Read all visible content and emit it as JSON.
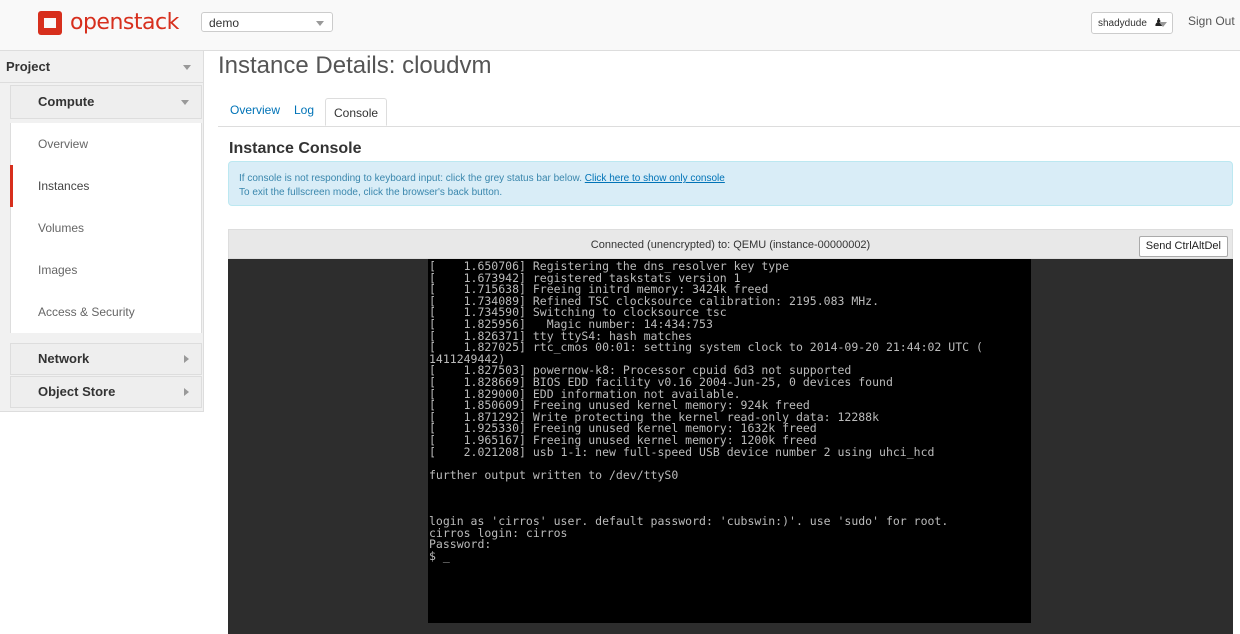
{
  "header": {
    "logo_text": "openstack",
    "project_select": "demo",
    "user_select": "shadydude",
    "sign_out": "Sign Out"
  },
  "sidebar": {
    "project_label": "Project",
    "compute_label": "Compute",
    "items": [
      "Overview",
      "Instances",
      "Volumes",
      "Images",
      "Access & Security"
    ],
    "active_item": "Instances",
    "network_label": "Network",
    "object_store_label": "Object Store"
  },
  "main": {
    "title": "Instance Details: cloudvm",
    "tabs": [
      "Overview",
      "Log",
      "Console"
    ],
    "active_tab": "Console",
    "section_title": "Instance Console",
    "info_line1": "If console is not responding to keyboard input: click the grey status bar below.",
    "info_link": "Click here to show only console",
    "info_line2": "To exit the fullscreen mode, click the browser's back button.",
    "console_status": "Connected (unencrypted) to: QEMU (instance-00000002)",
    "send_ctrl_alt_del": "Send CtrlAltDel"
  },
  "terminal": {
    "lines": [
      "[    1.650706] Registering the dns_resolver key type",
      "[    1.673942] registered taskstats version 1",
      "[    1.715638] Freeing initrd memory: 3424k freed",
      "[    1.734089] Refined TSC clocksource calibration: 2195.083 MHz.",
      "[    1.734590] Switching to clocksource tsc",
      "[    1.825956]   Magic number: 14:434:753",
      "[    1.826371] tty ttyS4: hash matches",
      "[    1.827025] rtc_cmos 00:01: setting system clock to 2014-09-20 21:44:02 UTC (",
      "1411249442)",
      "[    1.827503] powernow-k8: Processor cpuid 6d3 not supported",
      "[    1.828669] BIOS EDD facility v0.16 2004-Jun-25, 0 devices found",
      "[    1.829000] EDD information not available.",
      "[    1.850609] Freeing unused kernel memory: 924k freed",
      "[    1.871292] Write protecting the kernel read-only data: 12288k",
      "[    1.925330] Freeing unused kernel memory: 1632k freed",
      "[    1.965167] Freeing unused kernel memory: 1200k freed",
      "[    2.021208] usb 1-1: new full-speed USB device number 2 using uhci_hcd",
      "",
      "further output written to /dev/ttyS0",
      "",
      "",
      "",
      "login as 'cirros' user. default password: 'cubswin:)'. use 'sudo' for root.",
      "cirros login: cirros",
      "Password:",
      "$ _"
    ]
  },
  "colors": {
    "brand": "#d72f1d",
    "link": "#0073b7",
    "info_bg": "#d9edf7",
    "terminal_bg": "#000000"
  },
  "icons": [
    "logo-icon",
    "user-icon",
    "chevron-down-icon",
    "chevron-right-icon"
  ]
}
